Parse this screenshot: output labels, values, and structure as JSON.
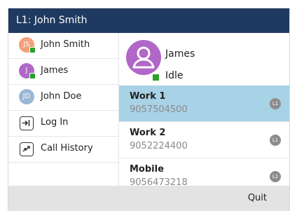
{
  "title": "L1: John Smith",
  "sidebar": {
    "items": [
      {
        "label": "John Smith",
        "initials": "JS",
        "avatar_color": "#f4a07a",
        "status_color": "#2ea02e"
      },
      {
        "label": "James",
        "initials": "J",
        "avatar_color": "#b067c8",
        "status_color": "#2ea02e"
      },
      {
        "label": "John Doe",
        "initials": "JD",
        "avatar_color": "#9ab7d6"
      },
      {
        "label": "Log In",
        "icon": "login-icon"
      },
      {
        "label": "Call History",
        "icon": "call-history-icon"
      }
    ]
  },
  "contact": {
    "name": "James",
    "status": "Idle",
    "avatar_color": "#b067c8",
    "status_color": "#2ea02e"
  },
  "numbers": [
    {
      "label": "Work 1",
      "value": "9057504500",
      "line": "L1",
      "selected": true
    },
    {
      "label": "Work 2",
      "value": "9052224400",
      "line": "L1",
      "selected": false
    },
    {
      "label": "Mobile",
      "value": "9056473218",
      "line": "L1",
      "selected": false
    }
  ],
  "softkeys": {
    "quit": "Quit"
  },
  "colors": {
    "titlebar": "#1f3a60",
    "selected_row": "#a8d2e6",
    "softkey_bar": "#e3e3e3"
  }
}
